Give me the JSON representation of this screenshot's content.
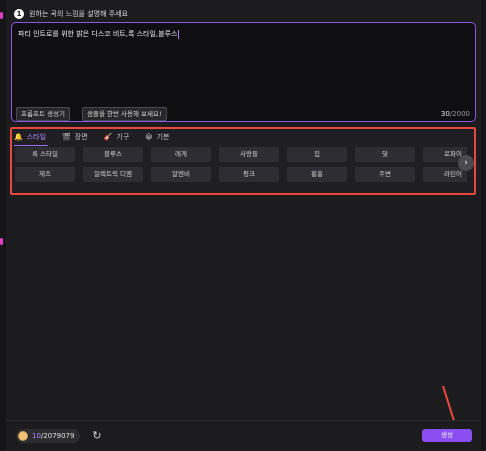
{
  "heading": {
    "step": "1",
    "text": "원하는 곡의 느낌을 설명해 주세요"
  },
  "prompt": {
    "value": "파티 인트로를 위한 밝은 디스코 비트,록 스타일,블루스",
    "char_count": "30",
    "char_limit": "/2000",
    "buttons": {
      "generator": "프롬프트 생성기",
      "try_sample": "샘플을 한번 사용해 보세요!"
    }
  },
  "tabs": [
    {
      "label": "스타일",
      "icon": "style-icon",
      "active": true
    },
    {
      "label": "장면",
      "icon": "scene-icon",
      "active": false
    },
    {
      "label": "기구",
      "icon": "instrument-icon",
      "active": false
    },
    {
      "label": "기분",
      "icon": "mood-icon",
      "active": false
    }
  ],
  "tags": [
    [
      "록 스타일",
      "블루스",
      "레게",
      "사랑들",
      "집",
      "덫",
      "로파이"
    ],
    [
      "재즈",
      "일렉트릭 디엠",
      "알엔비",
      "펑크",
      "휨홉",
      "주변",
      "라틴어"
    ]
  ],
  "credits": {
    "used": "10",
    "total": "/2079079"
  },
  "generate_label": "생성",
  "colors": {
    "accent": "#8a4df0",
    "highlight_border": "#e9493c",
    "annotation_arrow": "#e9493c"
  }
}
